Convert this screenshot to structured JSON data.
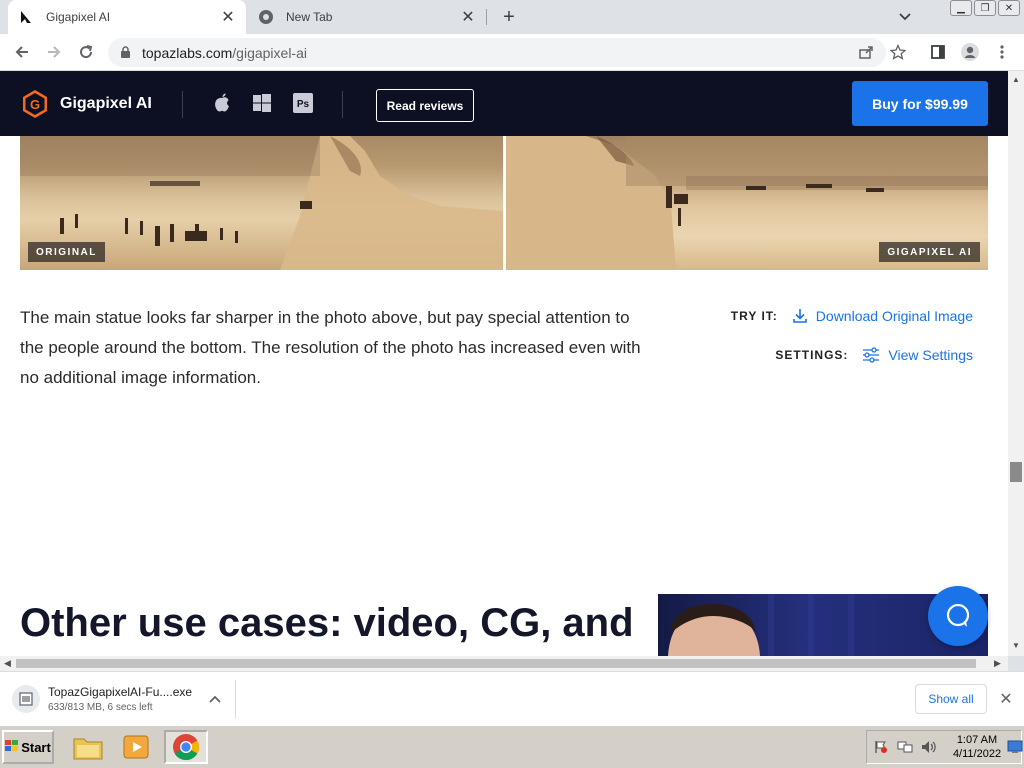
{
  "browser": {
    "tabs": [
      {
        "title": "Gigapixel AI",
        "active": true,
        "icon": "topaz-favicon-icon"
      },
      {
        "title": "New Tab",
        "active": false,
        "icon": "chrome-icon"
      }
    ],
    "url_host": "topazlabs.com",
    "url_path": "/gigapixel-ai"
  },
  "site": {
    "brand_name": "Gigapixel AI",
    "os_icons": [
      "apple-icon",
      "windows-icon",
      "photoshop-icon"
    ],
    "photoshop_badge": "Ps",
    "read_reviews": "Read reviews",
    "buy_label": "Buy for $99.99",
    "accent_color": "#1a73e8",
    "nav_bg": "#0c1022"
  },
  "comparison": {
    "left_label": "ORIGINAL",
    "right_label": "GIGAPIXEL AI"
  },
  "content": {
    "description": "The main statue looks far sharper in the photo above, but pay special attention to the people around the bottom. The resolution of the photo has increased even with no additional image information.",
    "try_label": "TRY IT:",
    "try_link": "Download Original Image",
    "settings_label": "SETTINGS:",
    "settings_link": "View Settings",
    "other_heading": "Other use cases: video, CG, and"
  },
  "downloads": {
    "file_name": "TopazGigapixelAI-Fu....exe",
    "status": "633/813 MB, 6 secs left",
    "show_all": "Show all"
  },
  "taskbar": {
    "start_label": "Start",
    "time": "1:07 AM",
    "date": "4/11/2022"
  }
}
